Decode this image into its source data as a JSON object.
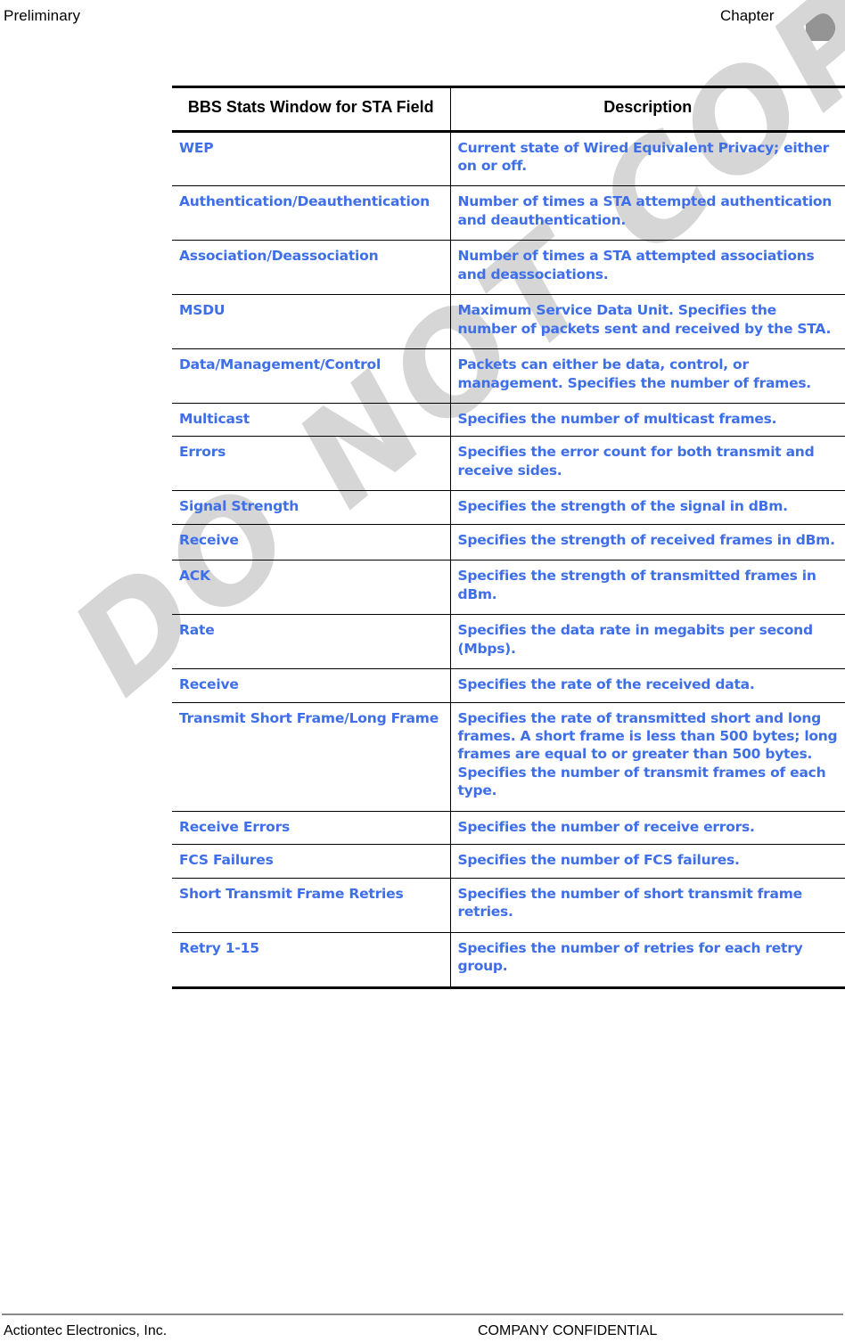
{
  "header": {
    "left_label": "Preliminary",
    "right_label": "Chapter"
  },
  "watermark": {
    "text": "DO NOT COPY"
  },
  "table": {
    "columns": [
      "BBS Stats Window for STA Field",
      "Description"
    ],
    "rows": [
      {
        "field": "WEP",
        "description": "Current state of Wired Equivalent Privacy; either on or off."
      },
      {
        "field": "Authentication/Deauthentication",
        "description": "Number of times a STA attempted authentication and deauthentication."
      },
      {
        "field": "Association/Deassociation",
        "description": "Number of times a STA attempted associations and deassociations."
      },
      {
        "field": "MSDU",
        "description": "Maximum Service Data Unit. Specifies the number of packets sent and received by the STA."
      },
      {
        "field": "Data/Management/Control",
        "description": "Packets can either be data, control, or management. Specifies the number of frames."
      },
      {
        "field": "Multicast",
        "description": "Specifies the number of multicast frames."
      },
      {
        "field": "Errors",
        "description": "Specifies the error count for both transmit and receive sides."
      },
      {
        "field": "Signal Strength",
        "description": "Specifies the strength of the signal in dBm."
      },
      {
        "field": "Receive",
        "description": "Specifies the strength of received frames in dBm."
      },
      {
        "field": "ACK",
        "description": "Specifies the strength of transmitted frames in dBm."
      },
      {
        "field": "Rate",
        "description": "Specifies the data rate in megabits per second (Mbps)."
      },
      {
        "field": "Receive",
        "description": "Specifies the rate of the received data."
      },
      {
        "field": "Transmit Short Frame/Long Frame",
        "description": "Specifies the rate of transmitted short and long frames. A short frame is less than 500 bytes; long frames are equal to or greater than 500 bytes. Specifies the number of transmit frames of each type."
      },
      {
        "field": "Receive Errors",
        "description": "Specifies the number of receive errors."
      },
      {
        "field": "FCS Failures",
        "description": "Specifies the number of FCS failures."
      },
      {
        "field": "Short Transmit Frame Retries",
        "description": "Specifies the number of short transmit frame retries."
      },
      {
        "field": "Retry 1-15",
        "description": "Specifies the number of retries for each retry group."
      }
    ]
  },
  "footer": {
    "left_label": "Actiontec Electronics, Inc.",
    "center_label": "COMPANY CONFIDENTIAL"
  },
  "colors": {
    "field_text": "#3f6fe8",
    "watermark": "#d6d6d6",
    "header_tab": "#949494",
    "footer_rule": "#8a8a8a"
  }
}
